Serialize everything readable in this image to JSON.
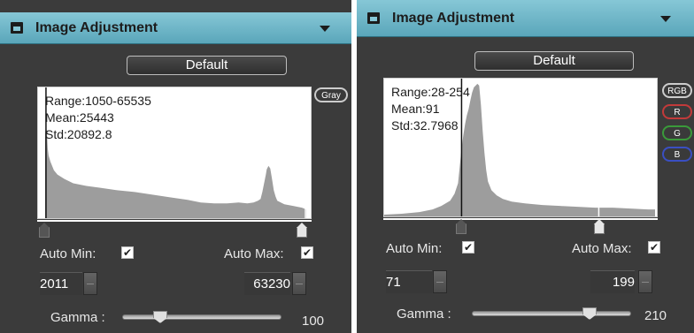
{
  "panels": [
    {
      "title": "Image Adjustment",
      "default_label": "Default",
      "stats": {
        "range": "Range:1050-65535",
        "mean": "Mean:25443",
        "std": "Std:20892.8"
      },
      "channel_buttons": [
        {
          "label": "Gray",
          "color": "#cccccc"
        }
      ],
      "auto_min_label": "Auto Min:",
      "auto_max_label": "Auto Max:",
      "auto_min_checked": true,
      "auto_max_checked": true,
      "min_value": "2011",
      "max_value": "63230",
      "gamma_label": "Gamma :",
      "gamma_value": "100",
      "gamma_position": 0.35
    },
    {
      "title": "Image Adjustment",
      "default_label": "Default",
      "stats": {
        "range": "Range:28-254",
        "mean": "Mean:91",
        "std": "Std:32.7968"
      },
      "channel_buttons": [
        {
          "label": "RGB",
          "color": "#cccccc"
        },
        {
          "label": "R",
          "color": "#c23a3a"
        },
        {
          "label": "G",
          "color": "#3a9a3a"
        },
        {
          "label": "B",
          "color": "#3a4fc2"
        }
      ],
      "auto_min_label": "Auto Min:",
      "auto_max_label": "Auto Max:",
      "auto_min_checked": true,
      "auto_max_checked": true,
      "min_value": "71",
      "max_value": "199",
      "gamma_label": "Gamma :",
      "gamma_value": "210",
      "gamma_position": 0.75
    }
  ]
}
